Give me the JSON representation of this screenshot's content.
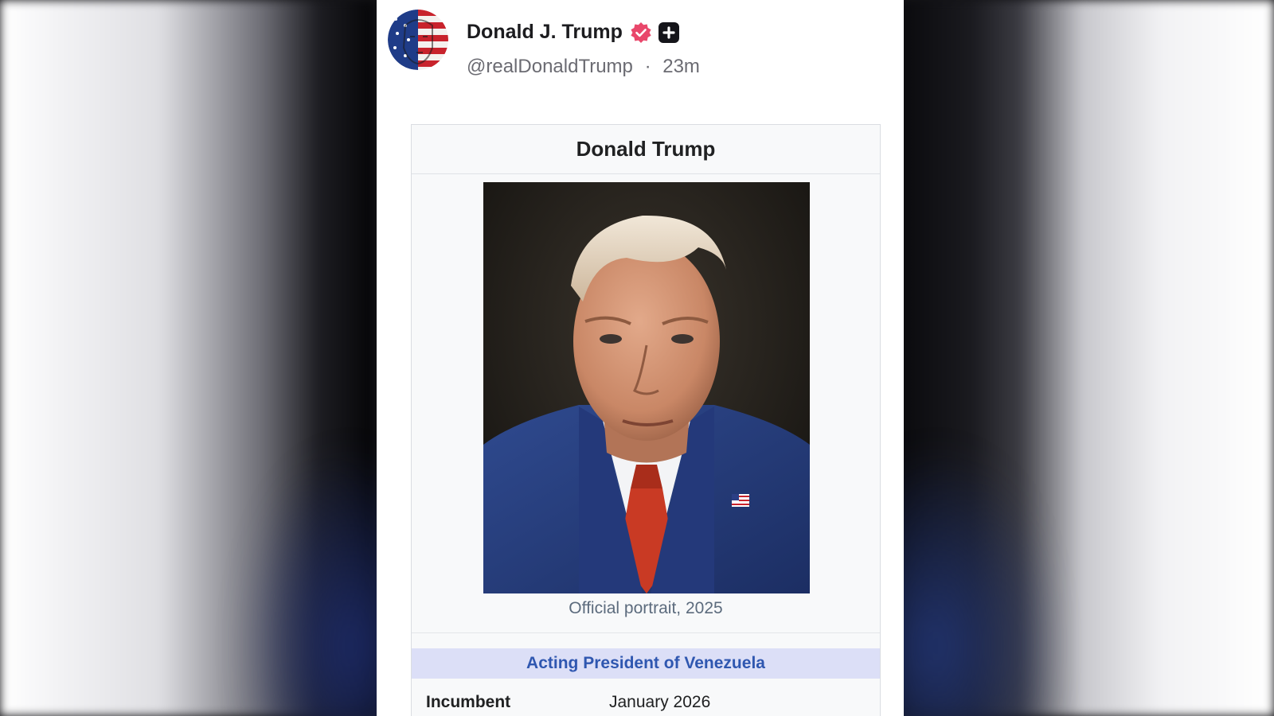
{
  "post": {
    "author_name": "Donald J. Trump",
    "handle": "@realDonaldTrump",
    "separator": "·",
    "time_ago": "23m",
    "badges": {
      "verified_icon": "verified-check-icon",
      "plus_icon": "plus-badge-icon",
      "verified_color": "#e9476b"
    }
  },
  "infobox": {
    "title": "Donald Trump",
    "image_caption": "Official portrait, 2025",
    "office_header": "Acting President of Venezuela",
    "rows": [
      {
        "label": "Incumbent",
        "value": "January 2026"
      }
    ]
  },
  "colors": {
    "office_header_bg": "#dcdff7",
    "office_header_text": "#2f57b0",
    "infobox_bg": "#f8f9fa"
  }
}
